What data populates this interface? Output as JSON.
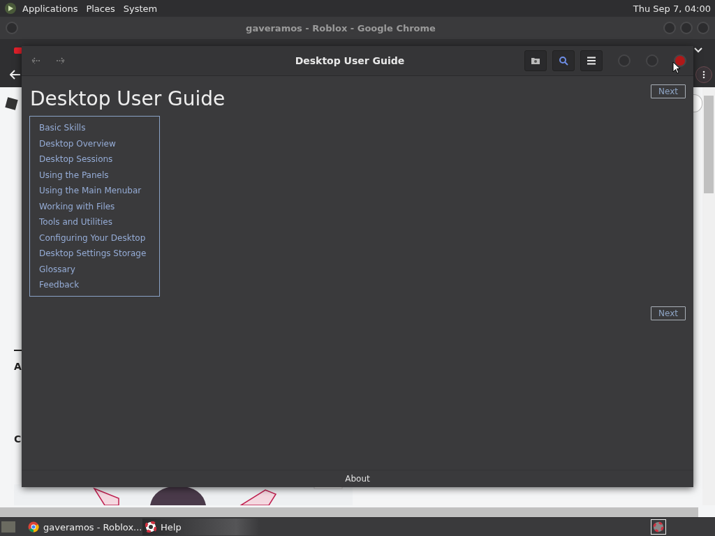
{
  "top_panel": {
    "menus": [
      "Applications",
      "Places",
      "System"
    ],
    "clock": "Thu Sep  7, 04:00"
  },
  "browser": {
    "title": "gaveramos - Roblox - Google Chrome",
    "page_fragments": [
      "A",
      "C"
    ]
  },
  "help_window": {
    "title": "Desktop User Guide",
    "heading": "Desktop User Guide",
    "topics": [
      "Basic Skills",
      "Desktop Overview",
      "Desktop Sessions",
      "Using the Panels",
      "Using the Main Menubar",
      "Working with Files",
      "Tools and Utilities",
      "Configuring Your Desktop",
      "Desktop Settings Storage",
      "Glossary",
      "Feedback"
    ],
    "next_buttons": [
      "Next",
      "Next"
    ],
    "footer": "About"
  },
  "taskbar": {
    "items": [
      {
        "kind": "chrome",
        "label": "gaveramos - Roblox...",
        "selected": false
      },
      {
        "kind": "help",
        "label": "Help",
        "selected": true
      }
    ]
  }
}
